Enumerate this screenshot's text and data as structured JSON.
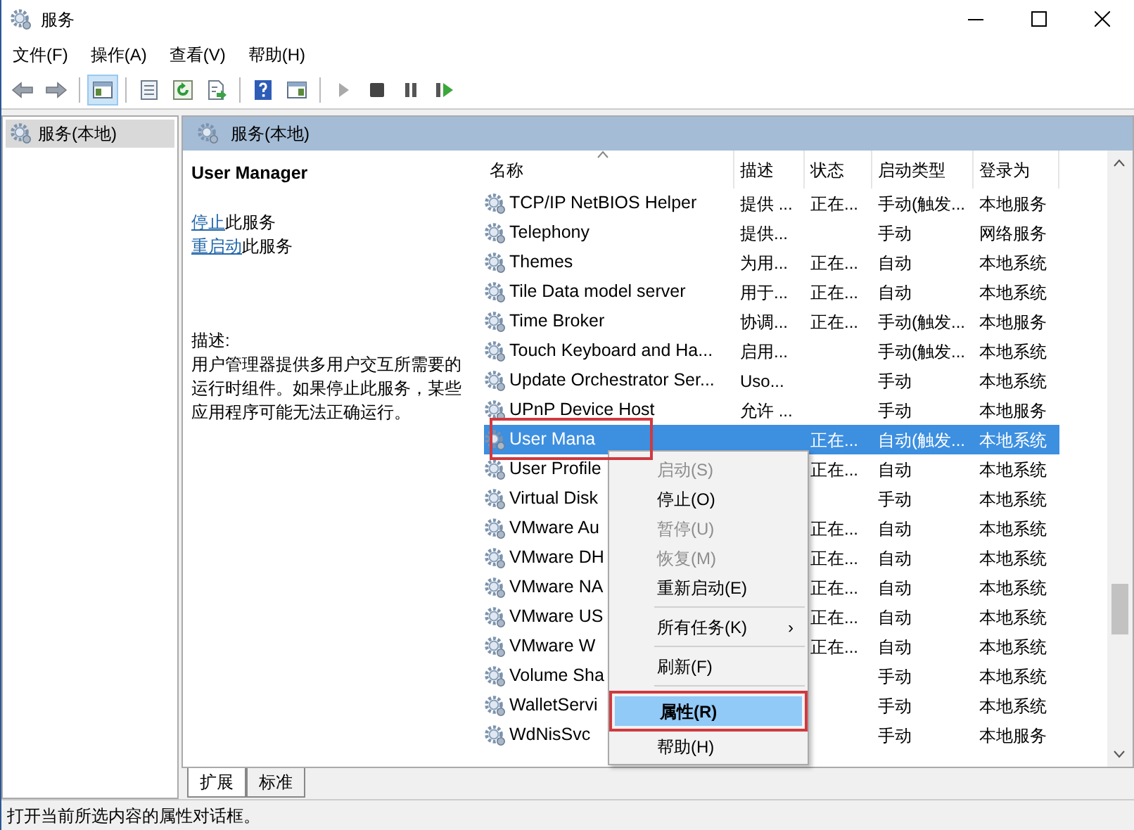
{
  "window": {
    "title": "服务"
  },
  "menu_bar": [
    "文件(F)",
    "操作(A)",
    "查看(V)",
    "帮助(H)"
  ],
  "toolbar": [
    {
      "kind": "back",
      "pressed": false
    },
    {
      "kind": "forward",
      "pressed": false
    },
    {
      "kind": "separator"
    },
    {
      "kind": "tree",
      "pressed": true
    },
    {
      "kind": "separator"
    },
    {
      "kind": "list",
      "pressed": false
    },
    {
      "kind": "refresh",
      "pressed": false
    },
    {
      "kind": "export",
      "pressed": false
    },
    {
      "kind": "separator"
    },
    {
      "kind": "help",
      "pressed": false
    },
    {
      "kind": "panel",
      "pressed": false
    },
    {
      "kind": "separator"
    },
    {
      "kind": "play",
      "pressed": false
    },
    {
      "kind": "stop",
      "pressed": false
    },
    {
      "kind": "pause",
      "pressed": false
    },
    {
      "kind": "resume",
      "pressed": false
    }
  ],
  "tree": [
    {
      "label": "服务(本地)",
      "selected": true
    }
  ],
  "pane_header": "服务(本地)",
  "detail": {
    "title": "User Manager",
    "actions": [
      {
        "link": "停止",
        "text": "此服务"
      },
      {
        "link": "重启动",
        "text": "此服务"
      }
    ],
    "description_label": "描述:",
    "description": "用户管理器提供多用户交互所需要的运行时组件。如果停止此服务，某些应用程序可能无法正确运行。"
  },
  "table": {
    "columns": [
      {
        "label": "名称",
        "sorted": true
      },
      {
        "label": "描述",
        "sorted": false
      },
      {
        "label": "状态",
        "sorted": false
      },
      {
        "label": "启动类型",
        "sorted": false
      },
      {
        "label": "登录为",
        "sorted": false
      }
    ],
    "rows": [
      {
        "name": "TCP/IP NetBIOS Helper",
        "description": "提供 ...",
        "status": "正在...",
        "startup": "手动(触发...",
        "logon": "本地服务",
        "selected": false,
        "highlighted": false
      },
      {
        "name": "Telephony",
        "description": "提供...",
        "status": "",
        "startup": "手动",
        "logon": "网络服务",
        "selected": false,
        "highlighted": false
      },
      {
        "name": "Themes",
        "description": "为用...",
        "status": "正在...",
        "startup": "自动",
        "logon": "本地系统",
        "selected": false,
        "highlighted": false
      },
      {
        "name": "Tile Data model server",
        "description": "用于...",
        "status": "正在...",
        "startup": "自动",
        "logon": "本地系统",
        "selected": false,
        "highlighted": false
      },
      {
        "name": "Time Broker",
        "description": "协调...",
        "status": "正在...",
        "startup": "手动(触发...",
        "logon": "本地服务",
        "selected": false,
        "highlighted": false
      },
      {
        "name": "Touch Keyboard and Ha...",
        "description": "启用...",
        "status": "",
        "startup": "手动(触发...",
        "logon": "本地系统",
        "selected": false,
        "highlighted": false
      },
      {
        "name": "Update Orchestrator Ser...",
        "description": "Uso...",
        "status": "",
        "startup": "手动",
        "logon": "本地系统",
        "selected": false,
        "highlighted": false
      },
      {
        "name": "UPnP Device Host",
        "description": "允许 ...",
        "status": "",
        "startup": "手动",
        "logon": "本地服务",
        "selected": false,
        "highlighted": false
      },
      {
        "name": "User Mana",
        "description": "",
        "status": "正在...",
        "startup": "自动(触发...",
        "logon": "本地系统",
        "selected": true,
        "highlighted": true
      },
      {
        "name": "User Profile",
        "description": "",
        "status": "正在...",
        "startup": "自动",
        "logon": "本地系统",
        "selected": false,
        "highlighted": false
      },
      {
        "name": "Virtual Disk",
        "description": "",
        "status": "",
        "startup": "手动",
        "logon": "本地系统",
        "selected": false,
        "highlighted": false
      },
      {
        "name": "VMware Au",
        "description": "",
        "status": "正在...",
        "startup": "自动",
        "logon": "本地系统",
        "selected": false,
        "highlighted": false
      },
      {
        "name": "VMware DH",
        "description": "",
        "status": "正在...",
        "startup": "自动",
        "logon": "本地系统",
        "selected": false,
        "highlighted": false
      },
      {
        "name": "VMware NA",
        "description": "",
        "status": "正在...",
        "startup": "自动",
        "logon": "本地系统",
        "selected": false,
        "highlighted": false
      },
      {
        "name": "VMware US",
        "description": "",
        "status": "正在...",
        "startup": "自动",
        "logon": "本地系统",
        "selected": false,
        "highlighted": false
      },
      {
        "name": "VMware W",
        "description": "",
        "status": "正在...",
        "startup": "自动",
        "logon": "本地系统",
        "selected": false,
        "highlighted": false
      },
      {
        "name": "Volume Sha",
        "description": "",
        "status": "",
        "startup": "手动",
        "logon": "本地系统",
        "selected": false,
        "highlighted": false
      },
      {
        "name": "WalletServi",
        "description": "",
        "status": "",
        "startup": "手动",
        "logon": "本地系统",
        "selected": false,
        "highlighted": false
      },
      {
        "name": "WdNisSvc",
        "description": "",
        "status": "",
        "startup": "手动",
        "logon": "本地服务",
        "selected": false,
        "highlighted": false
      }
    ]
  },
  "context_menu": {
    "items": [
      {
        "kind": "item",
        "label": "启动(S)",
        "disabled": true,
        "default": false,
        "selected": false,
        "highlighted": false
      },
      {
        "kind": "item",
        "label": "停止(O)",
        "disabled": false,
        "default": false,
        "selected": false,
        "highlighted": false
      },
      {
        "kind": "item",
        "label": "暂停(U)",
        "disabled": true,
        "default": false,
        "selected": false,
        "highlighted": false
      },
      {
        "kind": "item",
        "label": "恢复(M)",
        "disabled": true,
        "default": false,
        "selected": false,
        "highlighted": false
      },
      {
        "kind": "item",
        "label": "重新启动(E)",
        "disabled": false,
        "default": false,
        "selected": false,
        "highlighted": false
      },
      {
        "kind": "separator"
      },
      {
        "kind": "submenu",
        "label": "所有任务(K)",
        "arrow": "›",
        "disabled": false,
        "default": false,
        "selected": false,
        "highlighted": false
      },
      {
        "kind": "separator"
      },
      {
        "kind": "item",
        "label": "刷新(F)",
        "disabled": false,
        "default": false,
        "selected": false,
        "highlighted": false
      },
      {
        "kind": "separator"
      },
      {
        "kind": "item",
        "label": "属性(R)",
        "disabled": false,
        "default": true,
        "selected": true,
        "highlighted": true
      },
      {
        "kind": "item",
        "label": "帮助(H)",
        "disabled": false,
        "default": false,
        "selected": false,
        "highlighted": false
      }
    ]
  },
  "tabs": [
    {
      "label": "扩展",
      "selected": true
    },
    {
      "label": "标准",
      "selected": false
    }
  ],
  "status_bar": "打开当前所选内容的属性对话框。"
}
